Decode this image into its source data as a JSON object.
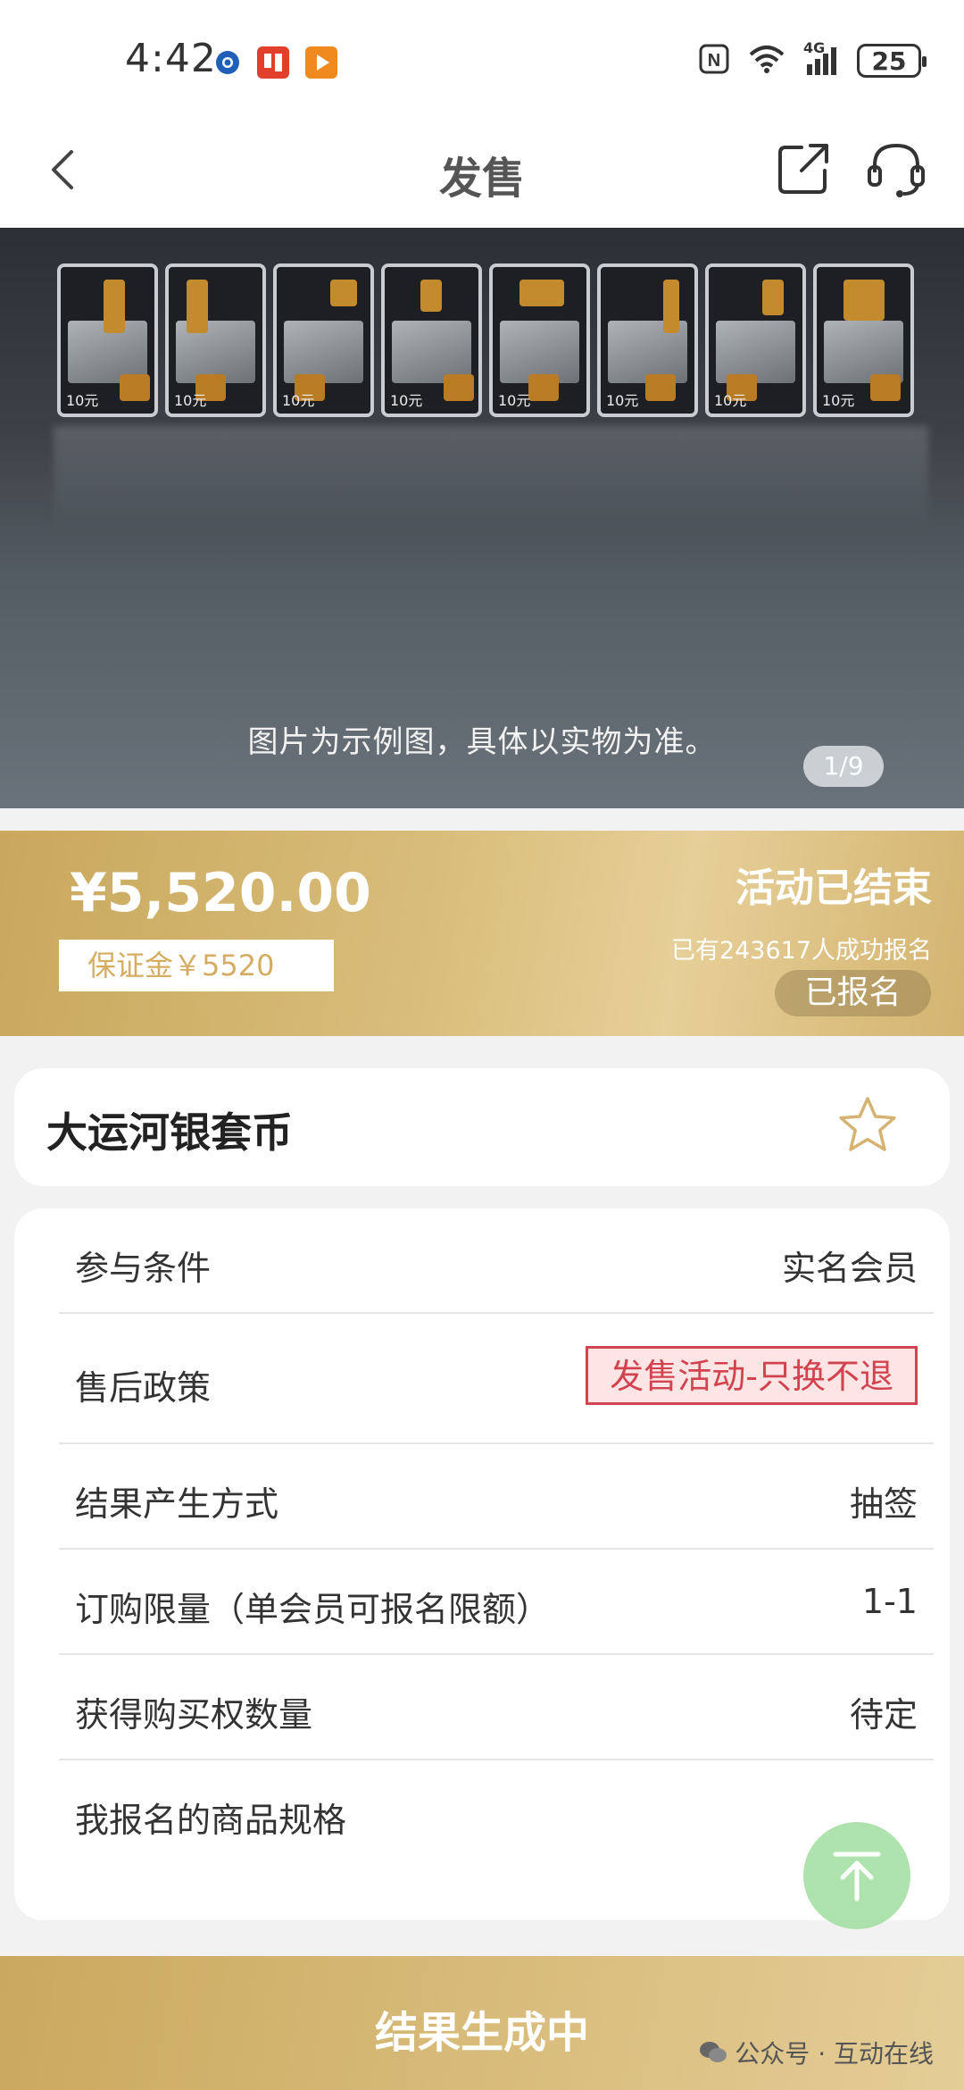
{
  "status_bar": {
    "time": "4:42",
    "battery": "25",
    "network": "4G",
    "left_app_icons": [
      "chrome-icon",
      "ting-app-icon",
      "video-app-icon"
    ],
    "right_icons": [
      "nfc-icon",
      "wifi-icon",
      "signal-icon",
      "battery-icon"
    ]
  },
  "header": {
    "title": "发售",
    "back_icon": "chevron-left-icon",
    "share_icon": "share-icon",
    "support_icon": "headset-icon"
  },
  "hero": {
    "caption": "图片为示例图，具体以实物为准。",
    "pager": "1/9",
    "coin_denomination": "10元",
    "coin_count": 8
  },
  "price_band": {
    "price": "¥5,520.00",
    "deposit": "保证金￥5520",
    "status": "活动已结束",
    "signup_count": "已有243617人成功报名",
    "signed_badge": "已报名"
  },
  "product": {
    "name": "大运河银套币",
    "favorite_icon": "star-outline-icon"
  },
  "info_rows": [
    {
      "label": "参与条件",
      "value": "实名会员"
    },
    {
      "label": "售后政策",
      "value": "发售活动-只换不退"
    },
    {
      "label": "结果产生方式",
      "value": "抽签"
    },
    {
      "label": "订购限量（单会员可报名限额）",
      "value": "1-1"
    },
    {
      "label": "获得购买权数量",
      "value": "待定"
    },
    {
      "label": "我报名的商品规格",
      "value": ""
    }
  ],
  "scroll_top_icon": "arrow-up-to-top-icon",
  "bottom_bar": {
    "label": "结果生成中",
    "watermark": "公众号 · 互动在线"
  },
  "colors": {
    "gold": "#d4b470",
    "policy_red": "#d1434f",
    "scroll_green": "#a0dea0"
  }
}
